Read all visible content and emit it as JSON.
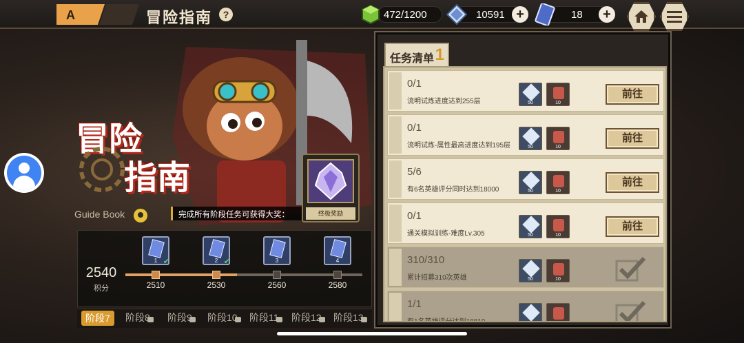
{
  "header": {
    "title": "冒险指南",
    "help_label": "?",
    "stamina": "472/1200",
    "diamonds": "10591",
    "tickets": "18",
    "plus_label": "+"
  },
  "hero": {
    "big_title_1": "冒险",
    "big_title_2": "指南",
    "guide_label": "Guide Book",
    "hint": "完成所有阶段任务可获得大奖：",
    "reward_label": "终极奖励"
  },
  "score": {
    "value": "2540",
    "label": "积分",
    "progress": 0.47,
    "milestones": [
      {
        "value": "2510",
        "ticket": "1",
        "claimed": true,
        "reached": true
      },
      {
        "value": "2530",
        "ticket": "2",
        "claimed": true,
        "reached": true
      },
      {
        "value": "2560",
        "ticket": "3",
        "claimed": false,
        "reached": false
      },
      {
        "value": "2580",
        "ticket": "4",
        "claimed": false,
        "reached": false
      }
    ]
  },
  "stages": [
    {
      "label": "阶段7",
      "active": true,
      "locked": false
    },
    {
      "label": "阶段8",
      "active": false,
      "locked": true
    },
    {
      "label": "阶段9",
      "active": false,
      "locked": true
    },
    {
      "label": "阶段10",
      "active": false,
      "locked": true
    },
    {
      "label": "阶段11",
      "active": false,
      "locked": true
    },
    {
      "label": "阶段12",
      "active": false,
      "locked": true
    },
    {
      "label": "阶段13",
      "active": false,
      "locked": true
    }
  ],
  "tasks_tab": {
    "label": "任务清单",
    "number": "1"
  },
  "tasks": [
    {
      "progress": "0/1",
      "desc": "流明试炼进度达到255层",
      "gem": "50",
      "bag": "10",
      "action": "前往",
      "done": false
    },
    {
      "progress": "0/1",
      "desc": "流明试炼-属性最高进度达到195层",
      "gem": "50",
      "bag": "10",
      "action": "前往",
      "done": false
    },
    {
      "progress": "5/6",
      "desc": "有6名英雄评分同时达到18000",
      "gem": "50",
      "bag": "10",
      "action": "前往",
      "done": false
    },
    {
      "progress": "0/1",
      "desc": "通关模拟训练-难度Lv.305",
      "gem": "50",
      "bag": "10",
      "action": "前往",
      "done": false
    },
    {
      "progress": "310/310",
      "desc": "累计招募310次英雄",
      "gem": "50",
      "bag": "10",
      "action": "",
      "done": true
    },
    {
      "progress": "1/1",
      "desc": "有1名英雄评分达到18810",
      "gem": "50",
      "bag": "10",
      "action": "",
      "done": true
    }
  ],
  "colors": {
    "accent": "#d99a2e",
    "progress": "#e3a064",
    "title_shadow": "#b5281b"
  }
}
